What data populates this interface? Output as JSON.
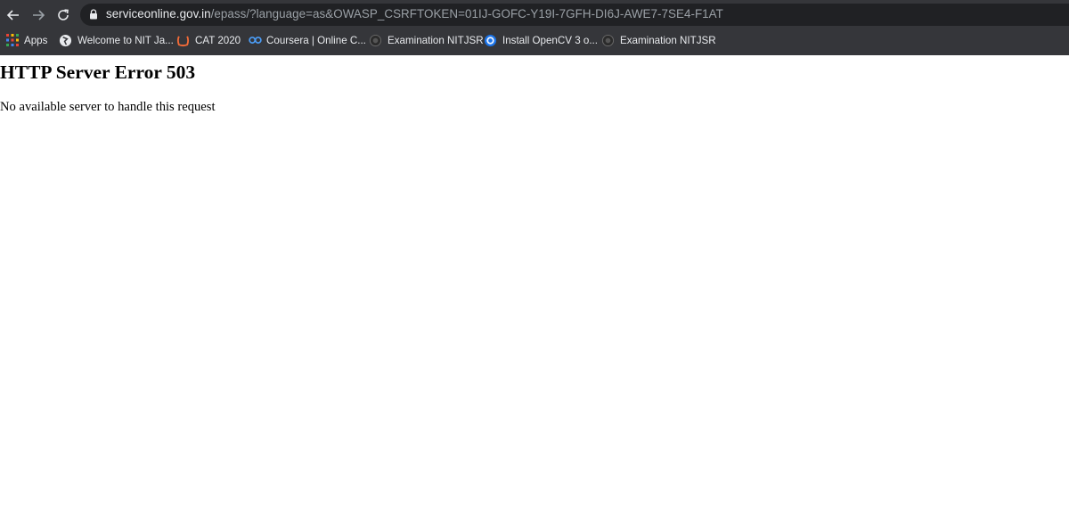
{
  "toolbar": {
    "back_icon": "arrow-left-icon",
    "forward_icon": "arrow-right-icon",
    "reload_icon": "reload-icon",
    "url_host": "serviceonline.gov.in",
    "url_rest": "/epass/?language=as&OWASP_CSRFTOKEN=01IJ-GOFC-Y19I-7GFH-DI6J-AWE7-7SE4-F1AT"
  },
  "bookmarks": [
    {
      "label": "Apps",
      "icon": "apps-grid-icon"
    },
    {
      "label": "Welcome to NIT Ja...",
      "icon": "globe-icon"
    },
    {
      "label": "CAT 2020",
      "icon": "cat-logo-icon"
    },
    {
      "label": "Coursera | Online C...",
      "icon": "coursera-icon"
    },
    {
      "label": "Examination NITJSR",
      "icon": "nit-logo-icon"
    },
    {
      "label": "Install OpenCV 3 o...",
      "icon": "blue-circle-icon"
    },
    {
      "label": "Examination NITJSR",
      "icon": "nit-logo-icon"
    }
  ],
  "page": {
    "heading": "HTTP Server Error 503",
    "message": "No available server to handle this request"
  },
  "colors": {
    "chrome_bg": "#35363a",
    "omnibox_bg": "#202124",
    "text_light": "#e8eaed",
    "text_dim": "#9aa0a6"
  }
}
